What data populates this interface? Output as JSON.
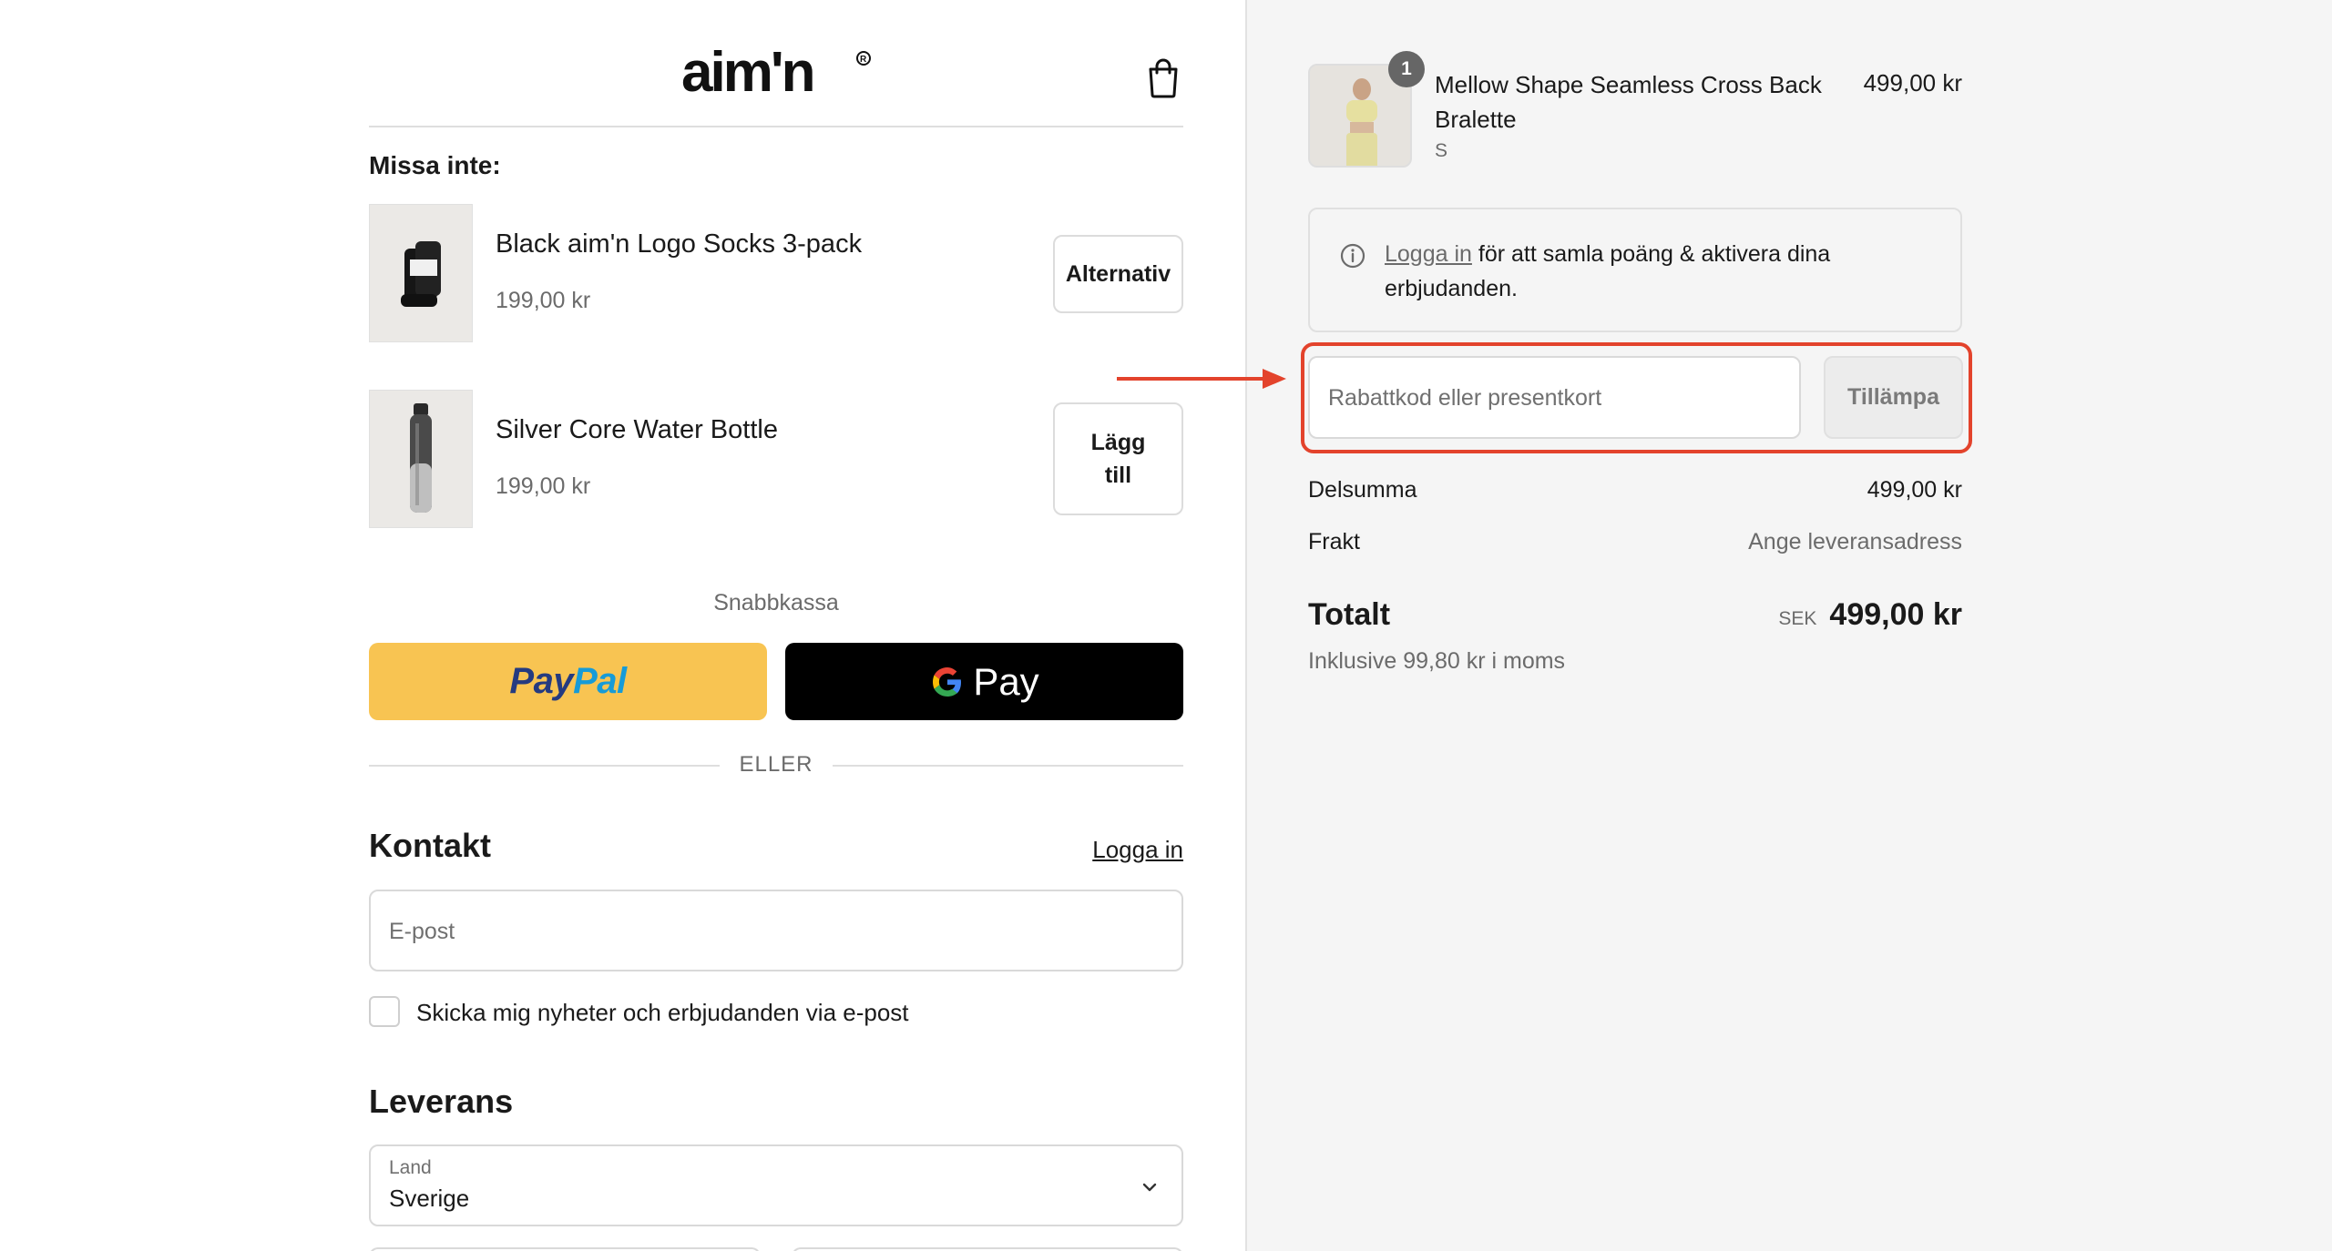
{
  "header": {
    "logo_text": "aim'n",
    "cart_icon": "shopping-bag-icon"
  },
  "upsell": {
    "title": "Missa inte:",
    "items": [
      {
        "name": "Black aim'n Logo Socks 3-pack",
        "price": "199,00 kr",
        "button": "Alternativ"
      },
      {
        "name": "Silver Core Water Bottle",
        "price": "199,00 kr",
        "button_line1": "Lägg",
        "button_line2": "till"
      }
    ]
  },
  "express": {
    "label": "Snabbkassa",
    "paypal_part1": "Pay",
    "paypal_part2": "Pal",
    "gpay_label": "Pay"
  },
  "divider": {
    "label": "ELLER"
  },
  "contact": {
    "title": "Kontakt",
    "login_link": "Logga in",
    "email_placeholder": "E-post",
    "newsletter_label": "Skicka mig nyheter och erbjudanden via e-post",
    "newsletter_checked": false
  },
  "delivery": {
    "title": "Leverans",
    "country_label": "Land",
    "country_value": "Sverige"
  },
  "summary": {
    "product": {
      "name": "Mellow Shape Seamless Cross Back Bralette",
      "variant": "S",
      "price": "499,00 kr",
      "quantity": "1"
    },
    "info": {
      "link": "Logga in",
      "text": " för att samla poäng & aktivera dina erbjudanden."
    },
    "discount": {
      "placeholder": "Rabattkod eller presentkort",
      "apply_label": "Tillämpa"
    },
    "subtotal_label": "Delsumma",
    "subtotal_value": "499,00 kr",
    "shipping_label": "Frakt",
    "shipping_value": "Ange leveransadress",
    "total_label": "Totalt",
    "currency": "SEK",
    "total_value": "499,00 kr",
    "tax_note": "Inklusive 99,80 kr i moms"
  },
  "colors": {
    "paypal_bg": "#f8c452",
    "paypal_dark": "#253b80",
    "paypal_light": "#179bd7",
    "gpay_bg": "#000000",
    "highlight": "#e3432c",
    "summary_bg": "#f5f5f5"
  }
}
